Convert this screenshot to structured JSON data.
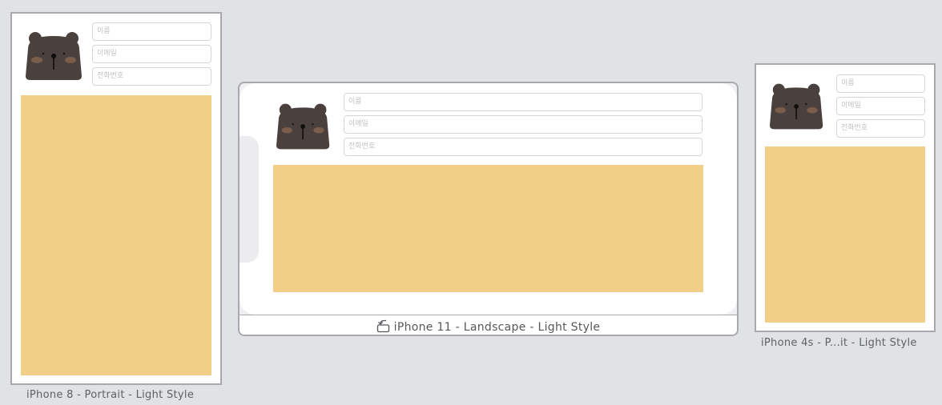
{
  "form": {
    "name_placeholder": "이름",
    "email_placeholder": "이메일",
    "phone_placeholder": "전화번호"
  },
  "devices": {
    "iphone8": {
      "label": "iPhone 8 - Portrait - Light Style"
    },
    "iphone11": {
      "label": "iPhone 11 - Landscape - Light Style"
    },
    "iphone4s": {
      "label": "iPhone 4s - P...it - Light Style"
    }
  },
  "icons": {
    "avatar": "bear-icon",
    "rotate": "rotate-icon"
  },
  "colors": {
    "canvas": "#e1e2e6",
    "panel": "#f2cf87",
    "bear": "#4a403d",
    "bear_cheek": "#7a5d4b"
  }
}
